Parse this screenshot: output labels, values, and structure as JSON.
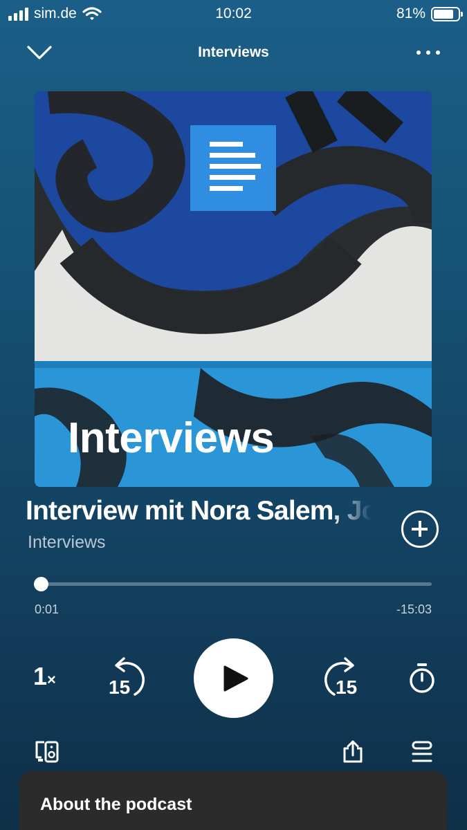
{
  "status": {
    "carrier": "sim.de",
    "time": "10:02",
    "battery": "81%",
    "battery_level": 0.81
  },
  "header": {
    "title": "Interviews",
    "close_icon": "chevron-down-icon",
    "more_icon": "more-dots-icon"
  },
  "artwork": {
    "label": "Interviews"
  },
  "episode": {
    "title": "Interview mit Nora Salem, Journalistin",
    "show": "Interviews"
  },
  "player": {
    "elapsed": "0:01",
    "remaining": "-15:03",
    "progress": 0.0011,
    "speed_value": "1",
    "speed_suffix": "×",
    "skip_back_seconds": "15",
    "skip_forward_seconds": "15"
  },
  "icons": {
    "add": "add-circle-icon",
    "play": "play-icon",
    "timer": "sleep-timer-icon",
    "devices": "connect-devices-icon",
    "share": "share-icon",
    "queue": "queue-icon"
  },
  "about": {
    "label": "About the podcast"
  }
}
